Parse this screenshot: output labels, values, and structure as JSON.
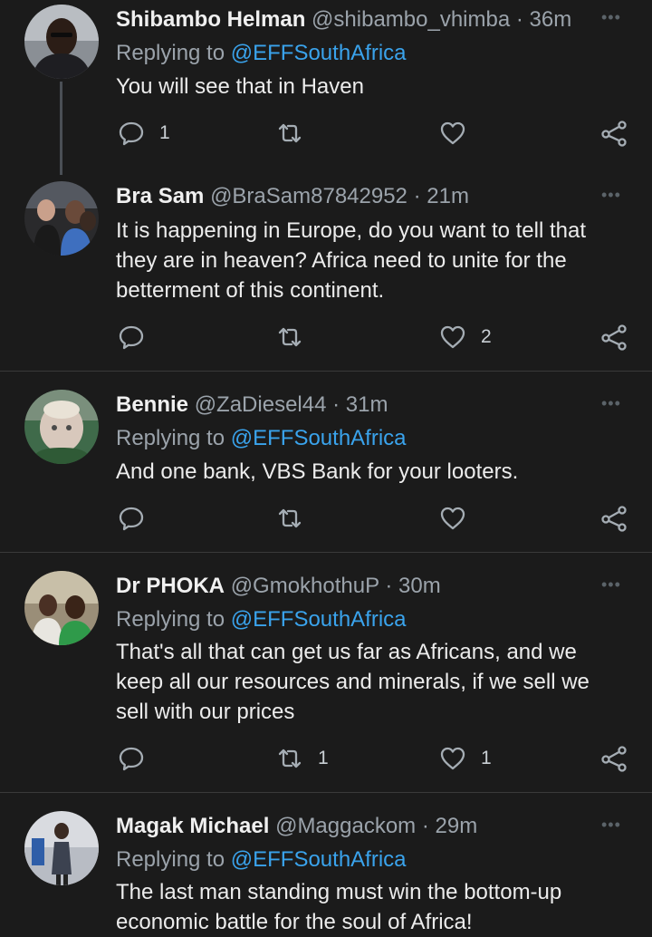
{
  "tweets": [
    {
      "name": "Shibambo Helman",
      "handle": "@shibambo_vhimba",
      "separator": "·",
      "time": "36m",
      "replying_prefix": "Replying to",
      "replying_to": "@EFFSouthAfrica",
      "text": "You will see that in Haven",
      "reply_count": "1",
      "retweet_count": "",
      "like_count": ""
    },
    {
      "name": "Bra Sam",
      "handle": "@BraSam87842952",
      "separator": "·",
      "time": "21m",
      "text": "It is happening in Europe, do you want to tell that they are in heaven? Africa need to unite for the betterment of this continent.",
      "reply_count": "",
      "retweet_count": "",
      "like_count": "2"
    },
    {
      "name": "Bennie",
      "handle": "@ZaDiesel44",
      "separator": "·",
      "time": "31m",
      "replying_prefix": "Replying to",
      "replying_to": "@EFFSouthAfrica",
      "text": "And one bank, VBS Bank for your looters.",
      "reply_count": "",
      "retweet_count": "",
      "like_count": ""
    },
    {
      "name": "Dr PHOKA",
      "handle": "@GmokhothuP",
      "separator": "·",
      "time": "30m",
      "replying_prefix": "Replying to",
      "replying_to": "@EFFSouthAfrica",
      "text": "That's all that can get us far as Africans, and we keep all our resources and minerals, if we sell we sell with our prices",
      "reply_count": "",
      "retweet_count": "1",
      "like_count": "1"
    },
    {
      "name": "Magak Michael",
      "handle": "@Maggackom",
      "separator": "·",
      "time": "29m",
      "replying_prefix": "Replying to",
      "replying_to": "@EFFSouthAfrica",
      "text": "The last man standing must win the bottom-up economic battle for the soul of Africa!",
      "reply_count": "",
      "retweet_count": "",
      "like_count": ""
    }
  ],
  "colors": {
    "background": "#1b1b1b",
    "mention": "#3aa3ec",
    "secondary_text": "#9ba3ab",
    "divider": "#3a3a3a"
  },
  "icons": [
    "reply-icon",
    "retweet-icon",
    "like-icon",
    "share-icon",
    "more-options-icon"
  ]
}
